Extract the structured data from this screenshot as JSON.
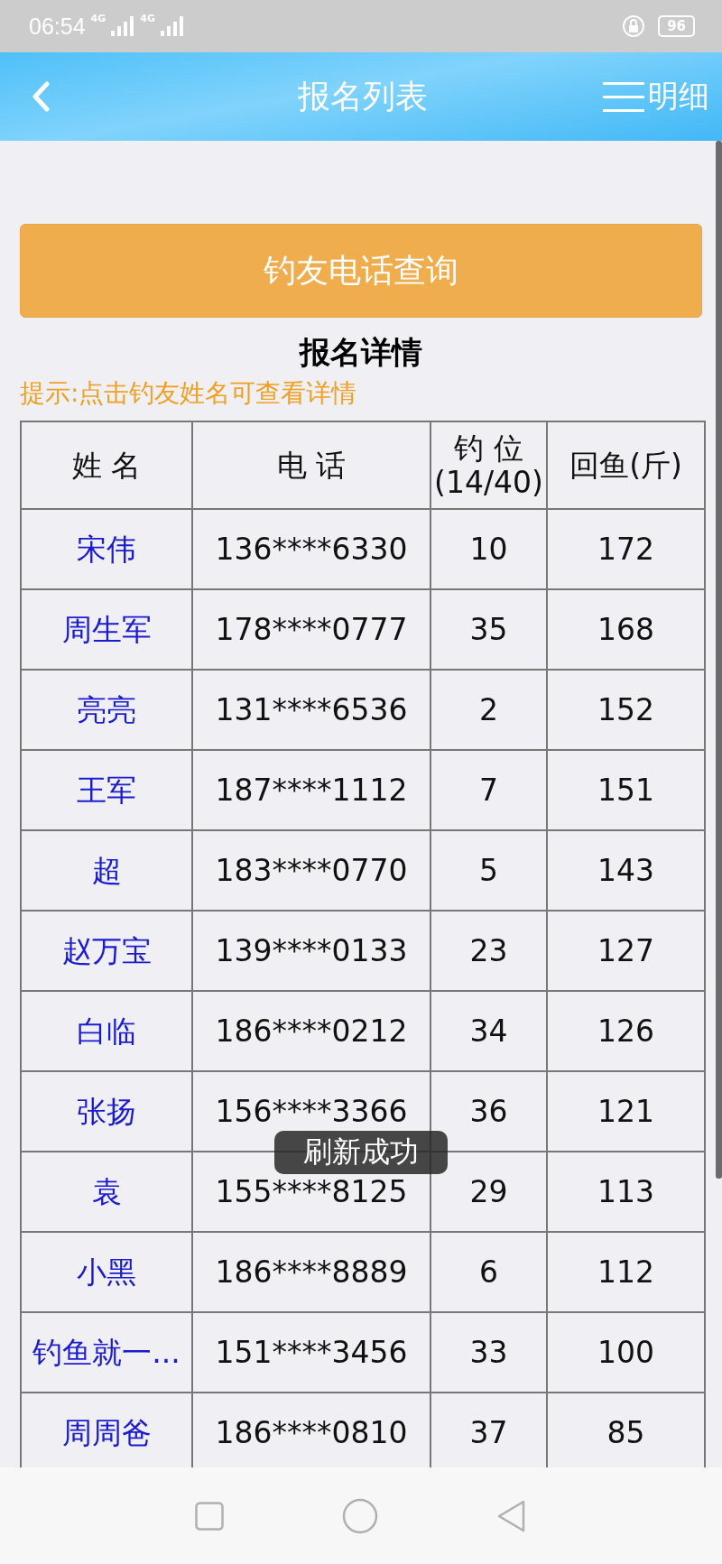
{
  "status_bar": {
    "time": "06:54",
    "networks": [
      "4G",
      "4G"
    ],
    "battery": "96"
  },
  "header": {
    "title": "报名列表",
    "menu_label": "明细"
  },
  "query_button": "钓友电话查询",
  "section_title": "报名详情",
  "hint": "提示:点击钓友姓名可查看详情",
  "table": {
    "columns": [
      {
        "label": "姓 名"
      },
      {
        "label": "电 话"
      },
      {
        "label": "钓 位",
        "sublabel": "(14/40)"
      },
      {
        "label": "回鱼(斤)"
      }
    ],
    "rows": [
      {
        "name": "宋伟",
        "phone": "136****6330",
        "seat": "10",
        "catch": "172"
      },
      {
        "name": "周生军",
        "phone": "178****0777",
        "seat": "35",
        "catch": "168"
      },
      {
        "name": "亮亮",
        "phone": "131****6536",
        "seat": "2",
        "catch": "152"
      },
      {
        "name": "王军",
        "phone": "187****1112",
        "seat": "7",
        "catch": "151"
      },
      {
        "name": "超",
        "phone": "183****0770",
        "seat": "5",
        "catch": "143"
      },
      {
        "name": "赵万宝",
        "phone": "139****0133",
        "seat": "23",
        "catch": "127"
      },
      {
        "name": "白临",
        "phone": "186****0212",
        "seat": "34",
        "catch": "126"
      },
      {
        "name": "张扬",
        "phone": "156****3366",
        "seat": "36",
        "catch": "121"
      },
      {
        "name": "袁",
        "phone": "155****8125",
        "seat": "29",
        "catch": "113"
      },
      {
        "name": "小黑",
        "phone": "186****8889",
        "seat": "6",
        "catch": "112"
      },
      {
        "name": "钓鱼就一...",
        "phone": "151****3456",
        "seat": "33",
        "catch": "100"
      },
      {
        "name": "周周爸",
        "phone": "186****0810",
        "seat": "37",
        "catch": "85"
      }
    ]
  },
  "toast": "刷新成功"
}
